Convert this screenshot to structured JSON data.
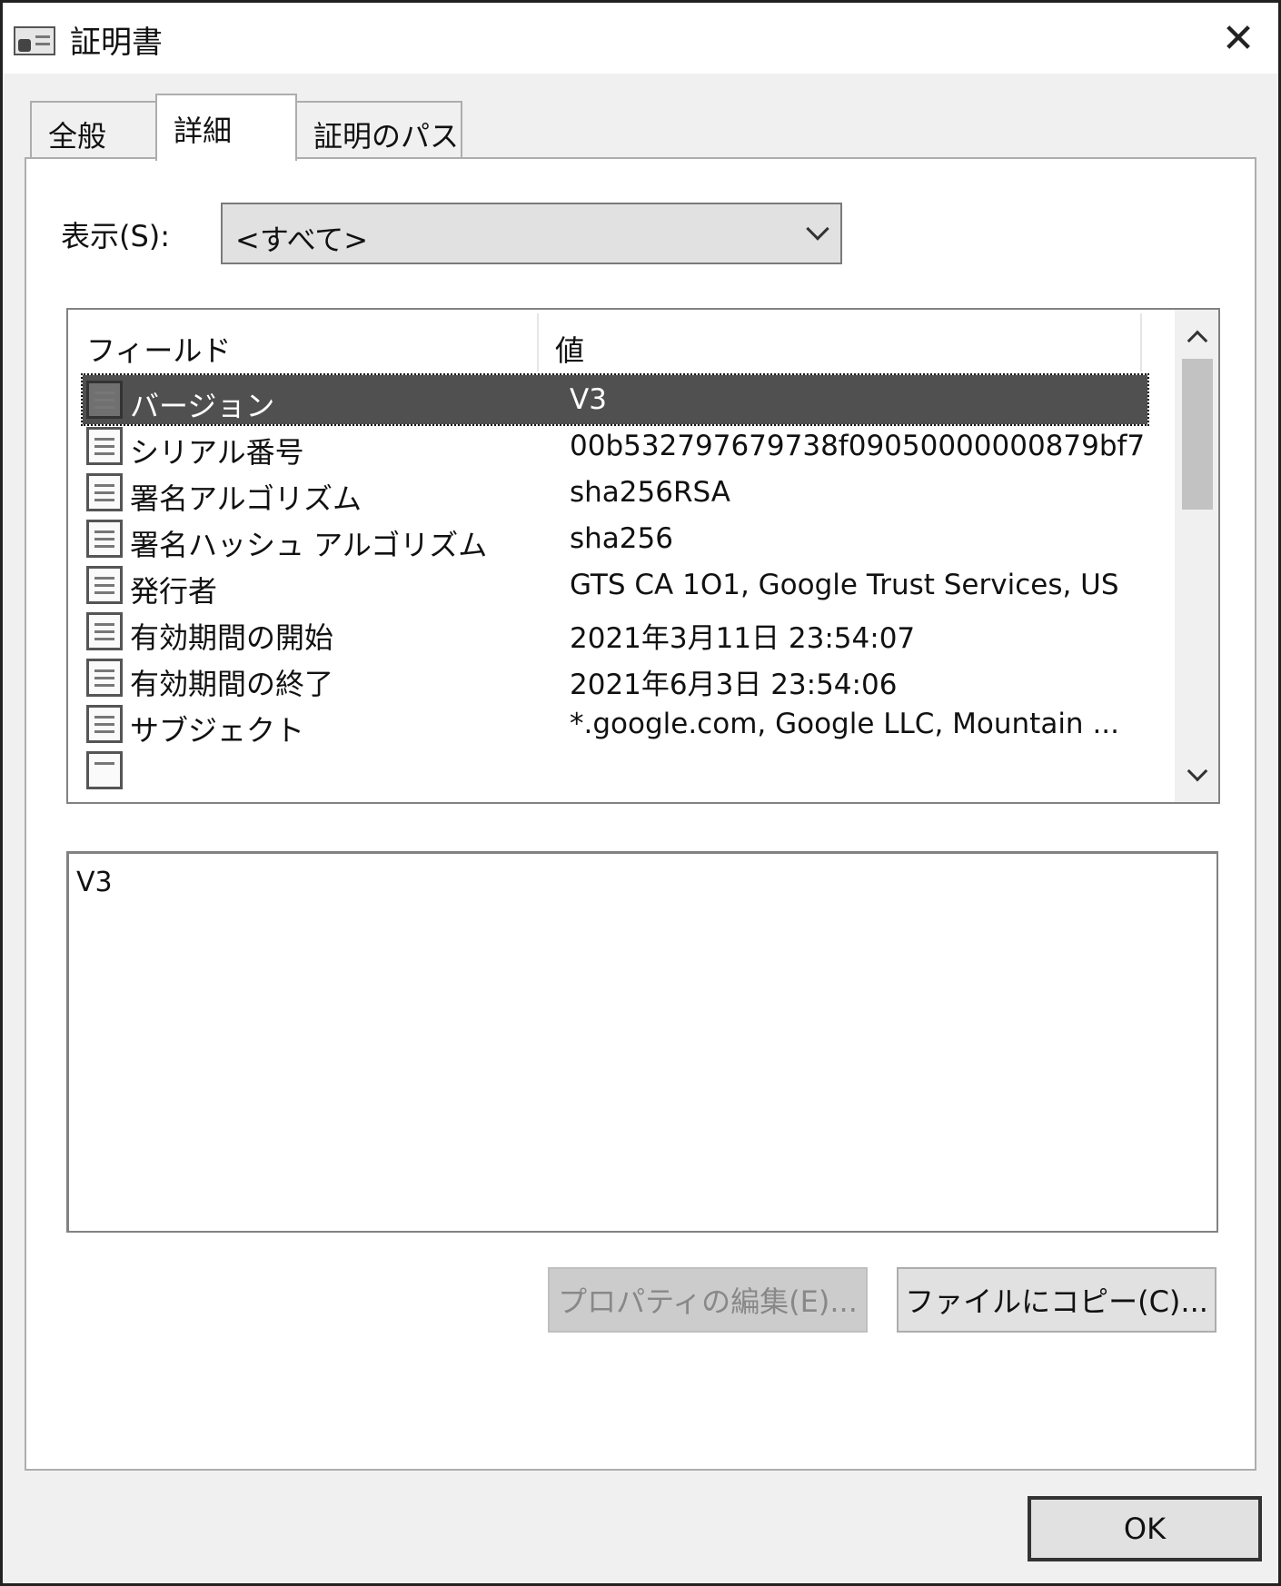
{
  "window": {
    "title": "証明書",
    "close_glyph": "✕"
  },
  "tabs": [
    {
      "label": "全般",
      "selected": false
    },
    {
      "label": "詳細",
      "selected": true
    },
    {
      "label": "証明のパス",
      "selected": false
    }
  ],
  "show": {
    "label": "表示(S):",
    "value": "<すべて>"
  },
  "list": {
    "columns": {
      "field": "フィールド",
      "value": "値"
    },
    "rows": [
      {
        "field": "バージョン",
        "value": "V3"
      },
      {
        "field": "シリアル番号",
        "value": "00b532797679738f09050000000879bf7"
      },
      {
        "field": "署名アルゴリズム",
        "value": "sha256RSA"
      },
      {
        "field": "署名ハッシュ アルゴリズム",
        "value": "sha256"
      },
      {
        "field": "発行者",
        "value": "GTS CA 1O1, Google Trust Services, US"
      },
      {
        "field": "有効期間の開始",
        "value": "2021年3月11日 23:54:07"
      },
      {
        "field": "有効期間の終了",
        "value": "2021年6月3日 23:54:06"
      },
      {
        "field": "サブジェクト",
        "value": "*.google.com, Google LLC, Mountain ..."
      }
    ],
    "selected_index": 0
  },
  "detail": {
    "text": "V3"
  },
  "buttons": {
    "edit_properties": "プロパティの編集(E)...",
    "copy_to_file": "ファイルにコピー(C)...",
    "ok": "OK"
  }
}
